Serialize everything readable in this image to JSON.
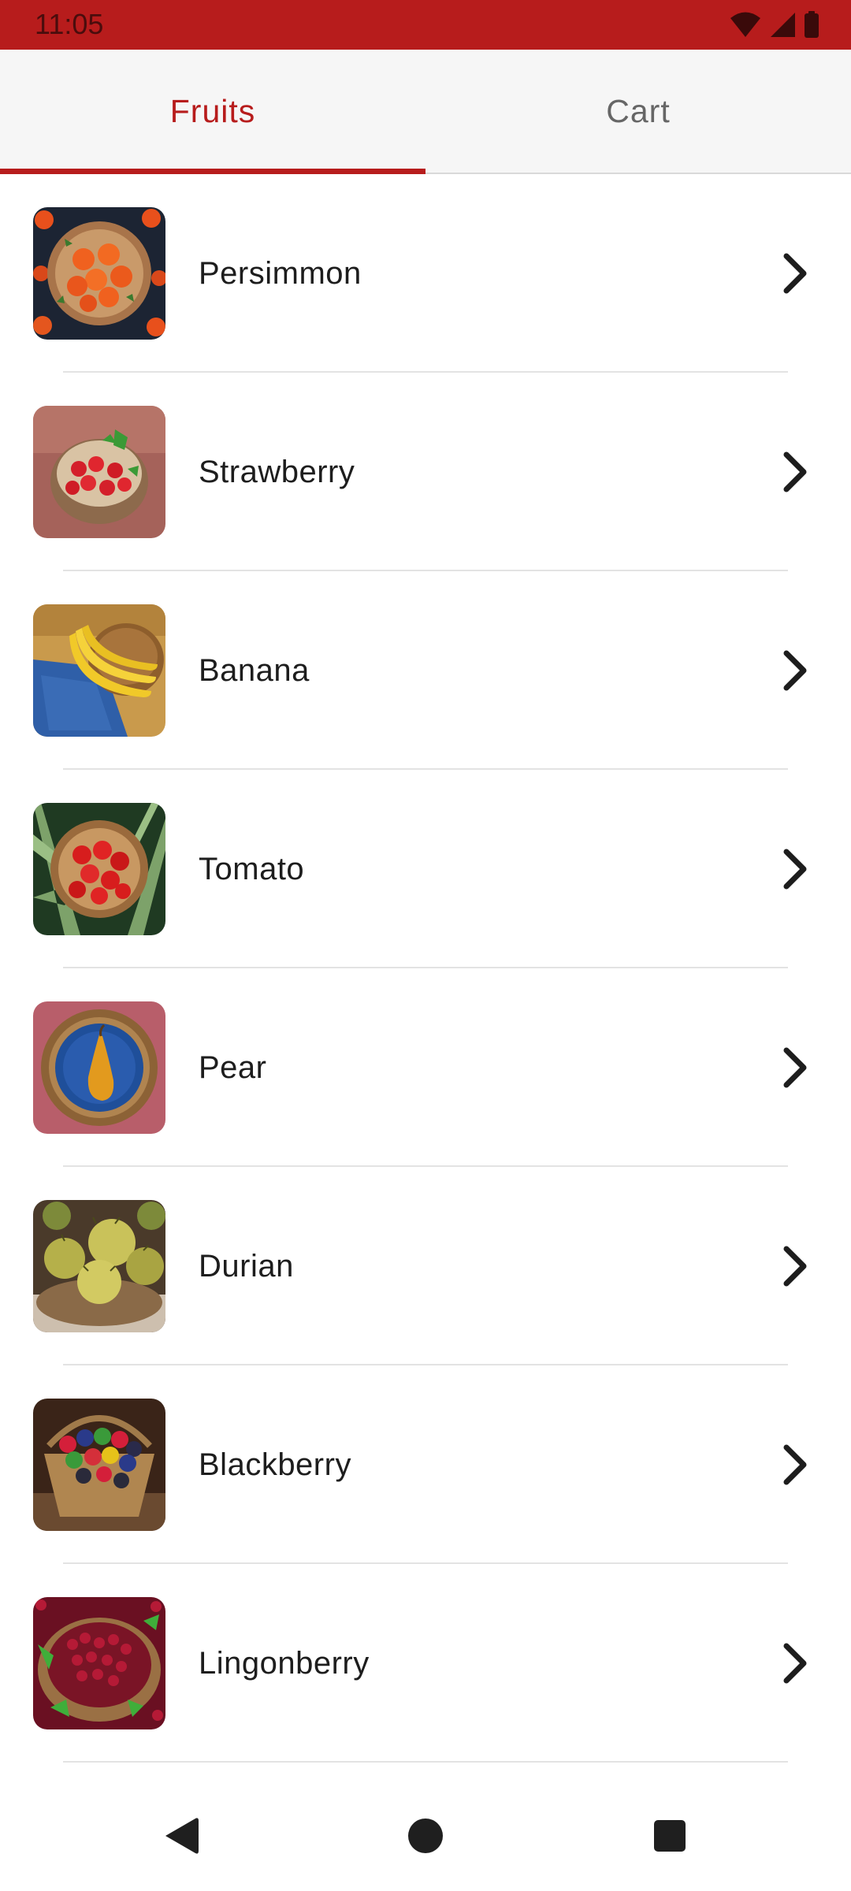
{
  "status_bar": {
    "time": "11:05",
    "icons": [
      "wifi-icon",
      "signal-icon",
      "battery-icon"
    ],
    "background": "#b71c1c"
  },
  "tabs": [
    {
      "label": "Fruits",
      "selected": true
    },
    {
      "label": "Cart",
      "selected": false
    }
  ],
  "accent_color": "#b71c1c",
  "fruits": [
    {
      "name": "Persimmon",
      "image": "persimmon-basket-image",
      "icon": "chevron-right-icon"
    },
    {
      "name": "Strawberry",
      "image": "strawberry-basket-image",
      "icon": "chevron-right-icon"
    },
    {
      "name": "Banana",
      "image": "banana-basket-image",
      "icon": "chevron-right-icon"
    },
    {
      "name": "Tomato",
      "image": "tomato-basket-image",
      "icon": "chevron-right-icon"
    },
    {
      "name": "Pear",
      "image": "pear-basket-image",
      "icon": "chevron-right-icon"
    },
    {
      "name": "Durian",
      "image": "durian-basket-image",
      "icon": "chevron-right-icon"
    },
    {
      "name": "Blackberry",
      "image": "blackberry-basket-image",
      "icon": "chevron-right-icon"
    },
    {
      "name": "Lingonberry",
      "image": "lingonberry-basket-image",
      "icon": "chevron-right-icon"
    }
  ],
  "nav_bar": {
    "icons": [
      "back-icon",
      "home-icon",
      "recents-icon"
    ]
  }
}
